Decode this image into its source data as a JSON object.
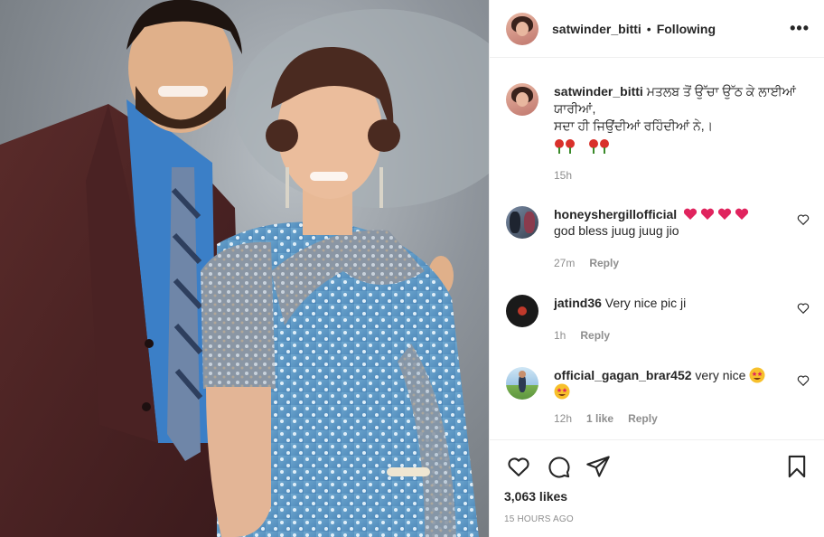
{
  "post": {
    "username": "satwinder_bitti",
    "separator": "•",
    "follow_status": "Following",
    "more_label": "•••"
  },
  "caption": {
    "username": "satwinder_bitti",
    "line1": "ਮਤਲਬ ਤੋਂ ਉੱਚਾ ਉੱਠ ਕੇ ਲਾਈਆਂ ਯਾਰੀਆਂ,",
    "line2": "ਸਦਾ ਹੀ ਜਿਉਂਦੀਆਂ ਰਹਿੰਦੀਆਂ ਨੇ,।",
    "time": "15h"
  },
  "comments": [
    {
      "username": "honeyshergillofficial",
      "text": "god bless juug juug jio",
      "time": "27m",
      "reply": "Reply"
    },
    {
      "username": "jatind36",
      "text": "Very nice pic ji",
      "time": "1h",
      "reply": "Reply"
    },
    {
      "username": "official_gagan_brar452",
      "text": "very nice",
      "time": "12h",
      "likes": "1 like",
      "reply": "Reply"
    }
  ],
  "footer": {
    "likes": "3,063 likes",
    "timestamp": "15 HOURS AGO"
  },
  "icons": [
    "heart-icon",
    "comment-icon",
    "share-icon",
    "bookmark-icon"
  ]
}
